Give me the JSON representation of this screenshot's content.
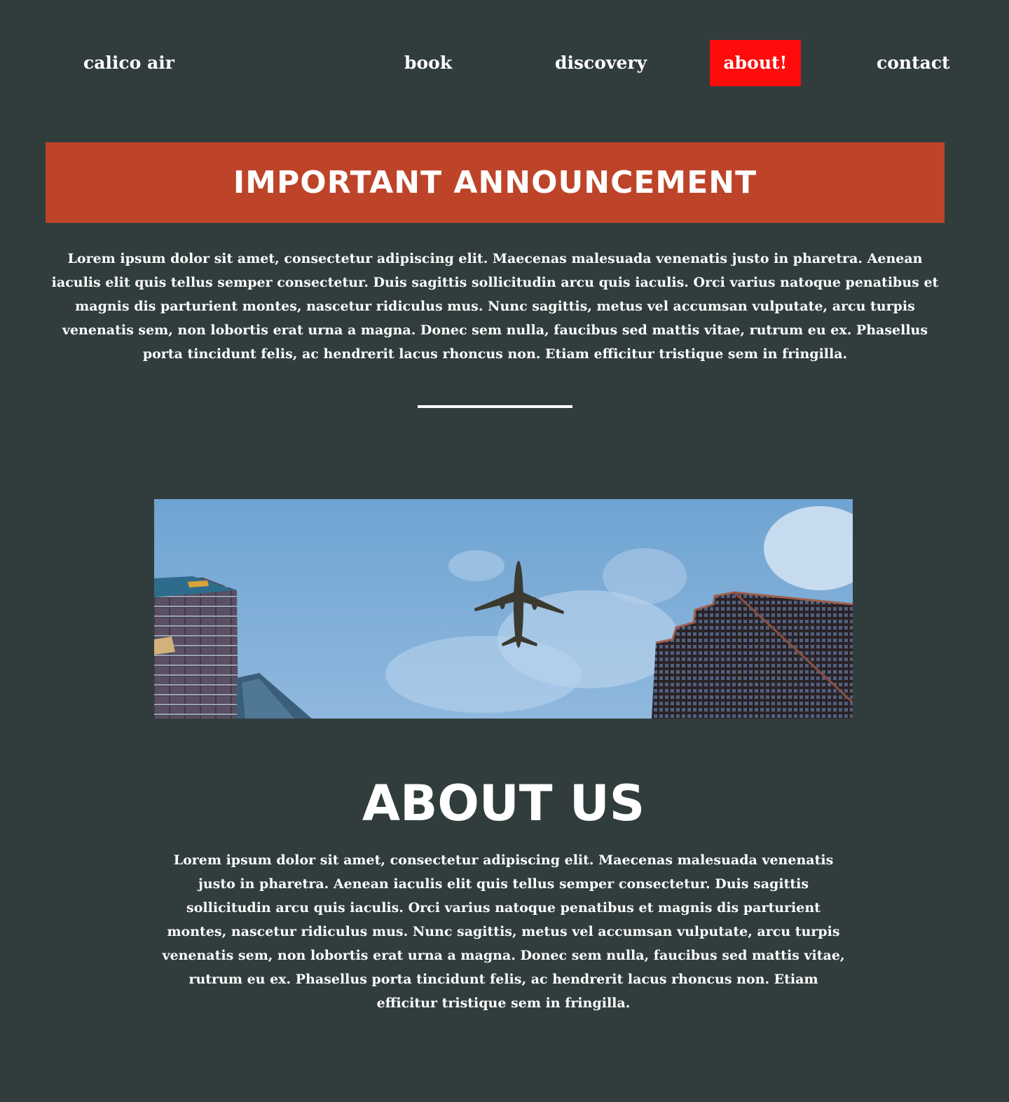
{
  "nav": {
    "brand": "calico air",
    "items": [
      {
        "label": "book",
        "active": false
      },
      {
        "label": "discovery",
        "active": false
      },
      {
        "label": "about!",
        "active": true
      },
      {
        "label": "contact",
        "active": false
      }
    ]
  },
  "announcement": {
    "title": "IMPORTANT ANNOUNCEMENT",
    "body": "Lorem ipsum dolor sit amet, consectetur adipiscing elit. Maecenas malesuada venenatis justo in pharetra. Aenean iaculis elit quis tellus semper consectetur. Duis sagittis sollicitudin arcu quis iaculis. Orci varius natoque penatibus et magnis dis parturient montes, nascetur ridiculus mus. Nunc sagittis, metus vel accumsan vulputate, arcu turpis venenatis sem, non lobortis erat urna a magna. Donec sem nulla, faucibus sed mattis vitae, rutrum eu ex. Phasellus porta tincidunt felis, ac hendrerit lacus rhoncus non. Etiam efficitur tristique sem in fringilla."
  },
  "about": {
    "title": "ABOUT US",
    "body": "Lorem ipsum dolor sit amet, consectetur adipiscing elit. Maecenas malesuada venenatis justo in pharetra. Aenean iaculis elit quis tellus semper consectetur. Duis sagittis sollicitudin arcu quis iaculis. Orci varius natoque penatibus et magnis dis parturient montes, nascetur ridiculus mus. Nunc sagittis, metus vel accumsan vulputate, arcu turpis venenatis sem, non lobortis erat urna a magna. Donec sem nulla, faucibus sed mattis vitae, rutrum eu ex. Phasellus porta tincidunt felis, ac hendrerit lacus rhoncus non. Etiam efficitur tristique sem in fringilla."
  },
  "colors": {
    "background": "#313d3d",
    "active_nav": "#ff0b0b",
    "banner": "#bd4429",
    "text": "#ffffff"
  }
}
